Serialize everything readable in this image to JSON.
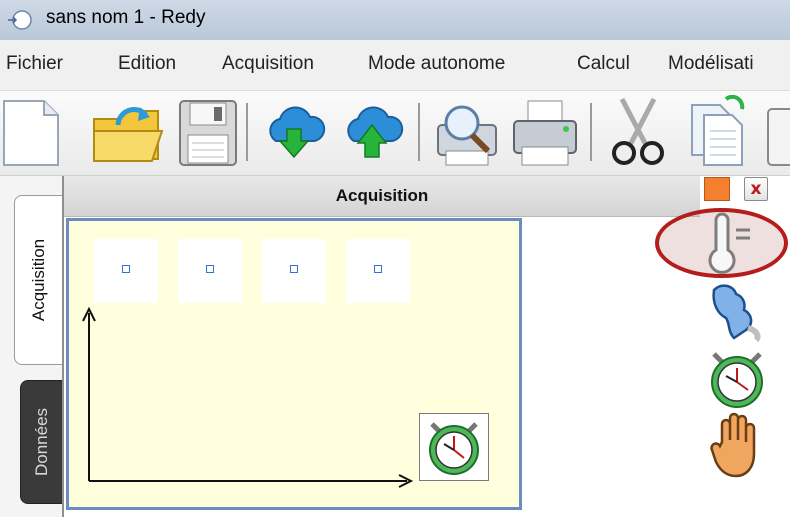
{
  "window": {
    "title": "sans nom 1 - Redy"
  },
  "menu": {
    "items": [
      "Fichier",
      "Edition",
      "Acquisition",
      "Mode autonome",
      "Calcul",
      "Modélisati"
    ]
  },
  "toolbar": {
    "buttons": [
      {
        "name": "new-file-icon"
      },
      {
        "name": "open-folder-icon"
      },
      {
        "name": "save-icon"
      },
      {
        "name": "download-cloud-icon"
      },
      {
        "name": "upload-cloud-icon"
      },
      {
        "name": "print-preview-icon"
      },
      {
        "name": "print-icon"
      },
      {
        "name": "cut-icon"
      },
      {
        "name": "copy-icon"
      },
      {
        "name": "paste-icon"
      }
    ]
  },
  "tabs": {
    "acquisition": "Acquisition",
    "donnees": "Données"
  },
  "panel": {
    "title": "Acquisition"
  },
  "close_label": "x",
  "colors": {
    "accent_orange": "#f47f2e",
    "close_red": "#c0181c",
    "canvas_bg": "#ffffdd",
    "canvas_border": "#6b8cbe",
    "highlight": "#b51d1d"
  },
  "side_icons": [
    "thermometer-icon",
    "hand-pointer-icon",
    "stopwatch-icon",
    "stop-hand-icon"
  ],
  "channels": 4
}
